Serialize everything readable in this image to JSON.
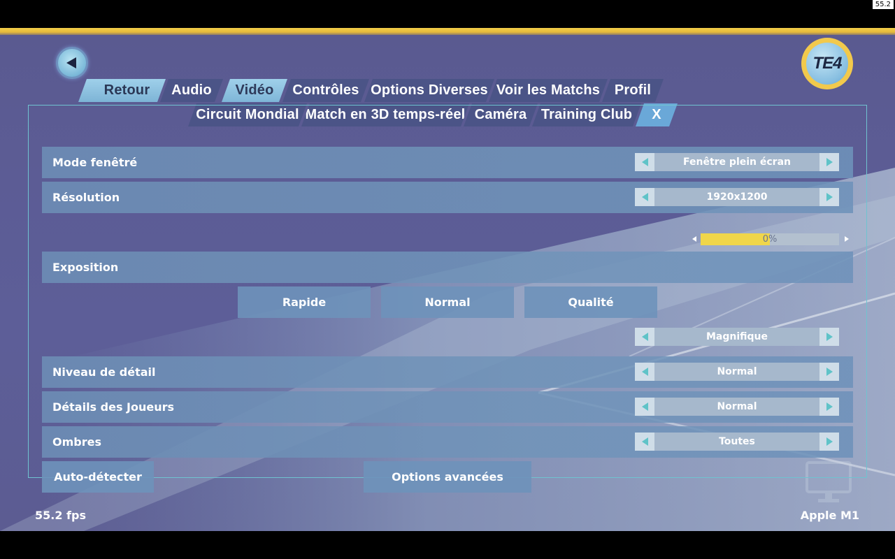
{
  "corner_fps": "55.2",
  "nav": {
    "back_label": "Retour",
    "tabs_row1": [
      "Audio",
      "Vidéo",
      "Contrôles",
      "Options Diverses",
      "Voir les Matchs",
      "Profil"
    ],
    "tabs_row2": [
      "Circuit Mondial",
      "Match en 3D temps-réel",
      "Caméra",
      "Training Club",
      "X"
    ],
    "active_tab": "Vidéo"
  },
  "logo_text": "TE4",
  "settings": {
    "mode": {
      "label": "Mode fenêtré",
      "value": "Fenêtre plein écran"
    },
    "resolution": {
      "label": "Résolution",
      "value": "1920x1200"
    },
    "exposure": {
      "label": "Exposition",
      "value_text": "0%",
      "fill_fraction": 0.5
    },
    "presets": [
      "Rapide",
      "Normal",
      "Qualité"
    ],
    "quality_preset": {
      "value": "Magnifique"
    },
    "detail": {
      "label": "Niveau de détail",
      "value": "Normal"
    },
    "player_details": {
      "label": "Détails des Joueurs",
      "value": "Normal"
    },
    "shadows": {
      "label": "Ombres",
      "value": "Toutes"
    }
  },
  "buttons": {
    "auto_detect": "Auto-détecter",
    "advanced": "Options avancées"
  },
  "footer": {
    "fps": "55.2 fps",
    "gpu": "Apple M1"
  },
  "colors": {
    "accent_yellow": "#f2c94c",
    "active_tab": "#9fd0ea",
    "panel_border": "#6fc3d0",
    "arrow_teal": "#5fc3c8"
  }
}
